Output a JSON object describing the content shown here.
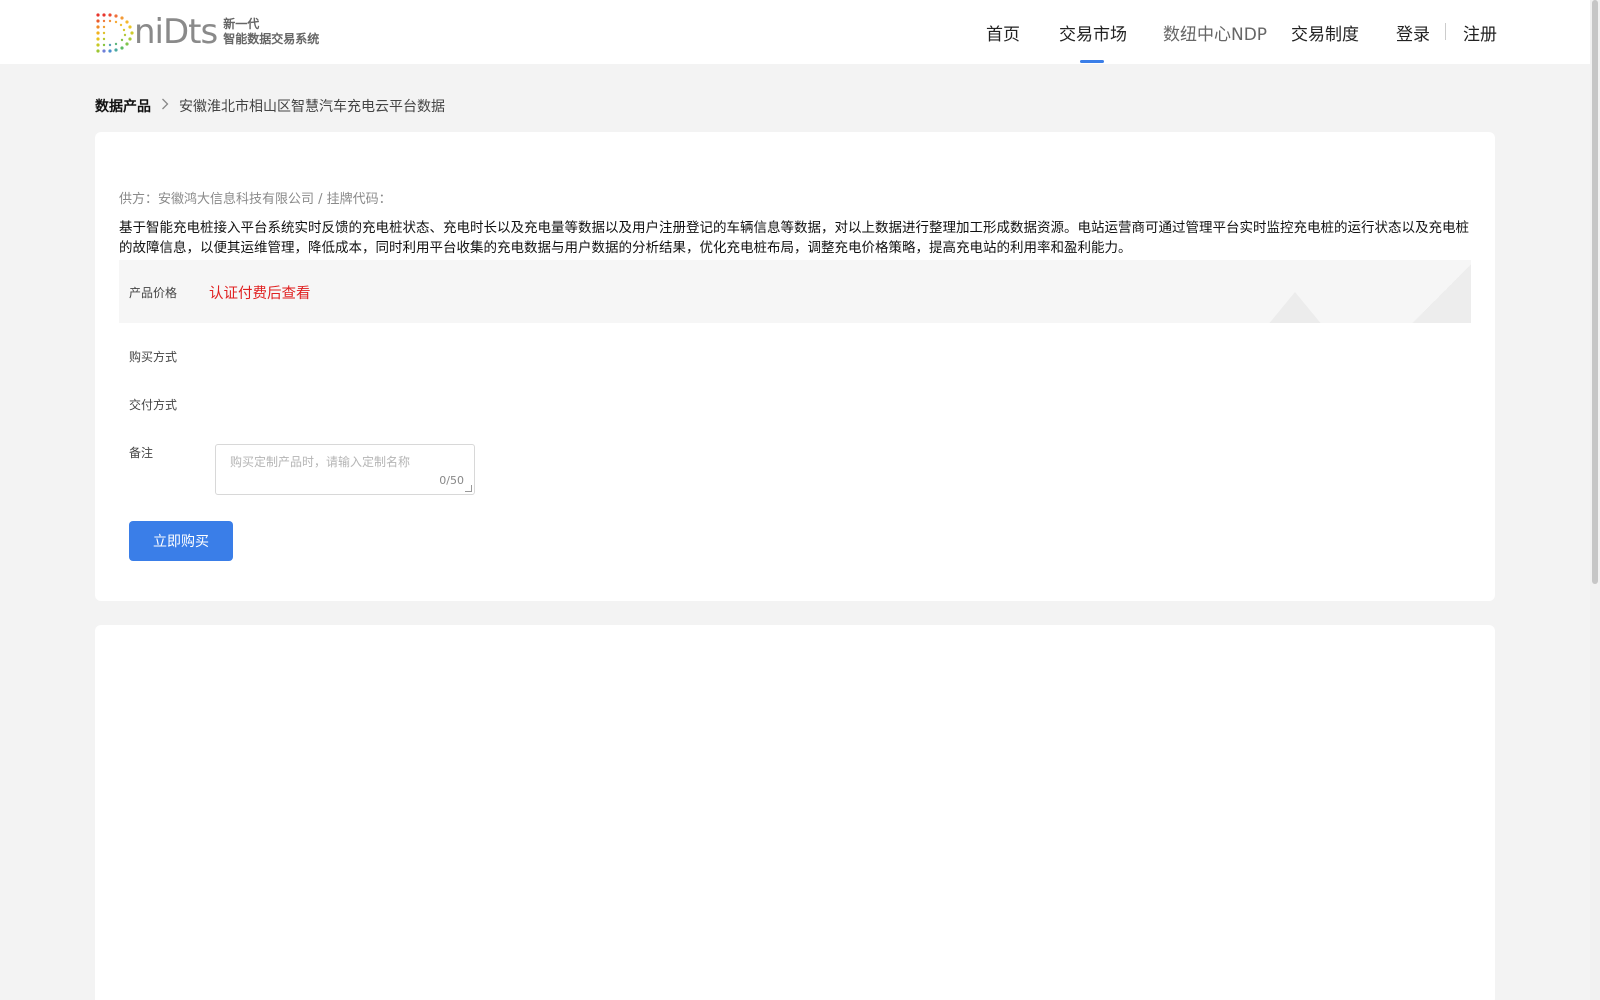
{
  "header": {
    "logo": {
      "wordmark": "niDts",
      "tagline_line1": "新一代",
      "tagline_line2": "智能数据交易系统"
    },
    "nav": [
      {
        "label": "首页",
        "active": false
      },
      {
        "label": "交易市场",
        "active": true
      },
      {
        "label": "数纽中心NDP",
        "active": false
      },
      {
        "label": "交易制度",
        "active": false
      }
    ],
    "login_label": "登录",
    "register_label": "注册",
    "accent_color": "#3a7ee8"
  },
  "breadcrumb": {
    "root": "数据产品",
    "separator_icon": "chevron-right-icon",
    "current": "安徽淮北市相山区智慧汽车充电云平台数据"
  },
  "product": {
    "supplier_line": "供方：安徽鸿大信息科技有限公司 / 挂牌代码：",
    "description": "基于智能充电桩接入平台系统实时反馈的充电桩状态、充电时长以及充电量等数据以及用户注册登记的车辆信息等数据，对以上数据进行整理加工形成数据资源。电站运营商可通过管理平台实时监控充电桩的运行状态以及充电桩的故障信息，以便其运维管理，降低成本，同时利用平台收集的充电数据与用户数据的分析结果，优化充电桩布局，调整充电价格策略，提高充电站的利用率和盈利能力。",
    "price_label": "产品价格",
    "price_value": "认证付费后查看",
    "price_color": "#e02020",
    "purchase_method_label": "购买方式",
    "delivery_method_label": "交付方式",
    "remark_label": "备注",
    "remark_placeholder": "购买定制产品时，请输入定制名称",
    "remark_counter": "0/50",
    "buy_button_label": "立即购买"
  }
}
